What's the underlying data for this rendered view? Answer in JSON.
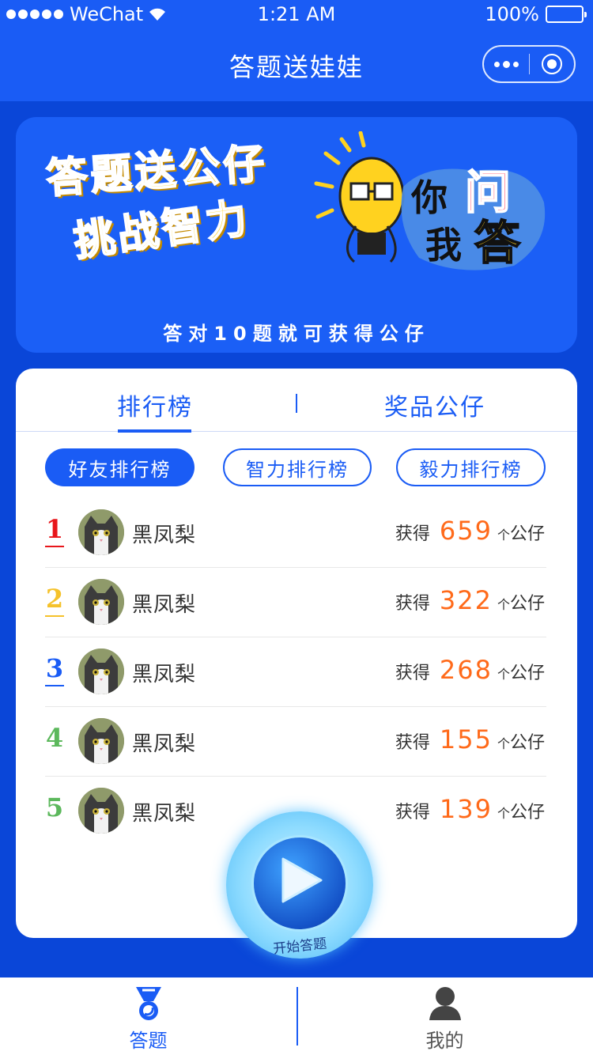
{
  "status_bar": {
    "carrier": "WeChat",
    "time": "1:21 AM",
    "battery": "100%"
  },
  "nav": {
    "title": "答题送娃娃"
  },
  "banner": {
    "line1": "答题送公仔",
    "line2": "挑战智力",
    "qa_ni": "你",
    "qa_wen": "问",
    "qa_wo": "我",
    "qa_da": "答",
    "subtitle": "答对10题就可获得公仔"
  },
  "tabs": {
    "rank": "排行榜",
    "prize": "奖品公仔"
  },
  "filters": {
    "friends": "好友排行榜",
    "intellect": "智力排行榜",
    "perseverance": "毅力排行榜"
  },
  "ranking": [
    {
      "rank": "1",
      "name": "黑凤梨",
      "prefix": "获得",
      "count": "659",
      "unit_a": "个",
      "unit_b": "公仔",
      "color": "#e8161b"
    },
    {
      "rank": "2",
      "name": "黑凤梨",
      "prefix": "获得",
      "count": "322",
      "unit_a": "个",
      "unit_b": "公仔",
      "color": "#f5c22b"
    },
    {
      "rank": "3",
      "name": "黑凤梨",
      "prefix": "获得",
      "count": "268",
      "unit_a": "个",
      "unit_b": "公仔",
      "color": "#1a5cf5"
    },
    {
      "rank": "4",
      "name": "黑凤梨",
      "prefix": "获得",
      "count": "155",
      "unit_a": "个",
      "unit_b": "公仔",
      "color": "#5cb85c"
    },
    {
      "rank": "5",
      "name": "黑凤梨",
      "prefix": "获得",
      "count": "139",
      "unit_a": "个",
      "unit_b": "公仔",
      "color": "#5cb85c"
    }
  ],
  "start_button": {
    "label": "开始答题"
  },
  "tabbar": {
    "quiz": "答题",
    "mine": "我的"
  },
  "colors": {
    "primary": "#1a5cf5",
    "background": "#0a46d8",
    "score": "#ff6a1a"
  }
}
